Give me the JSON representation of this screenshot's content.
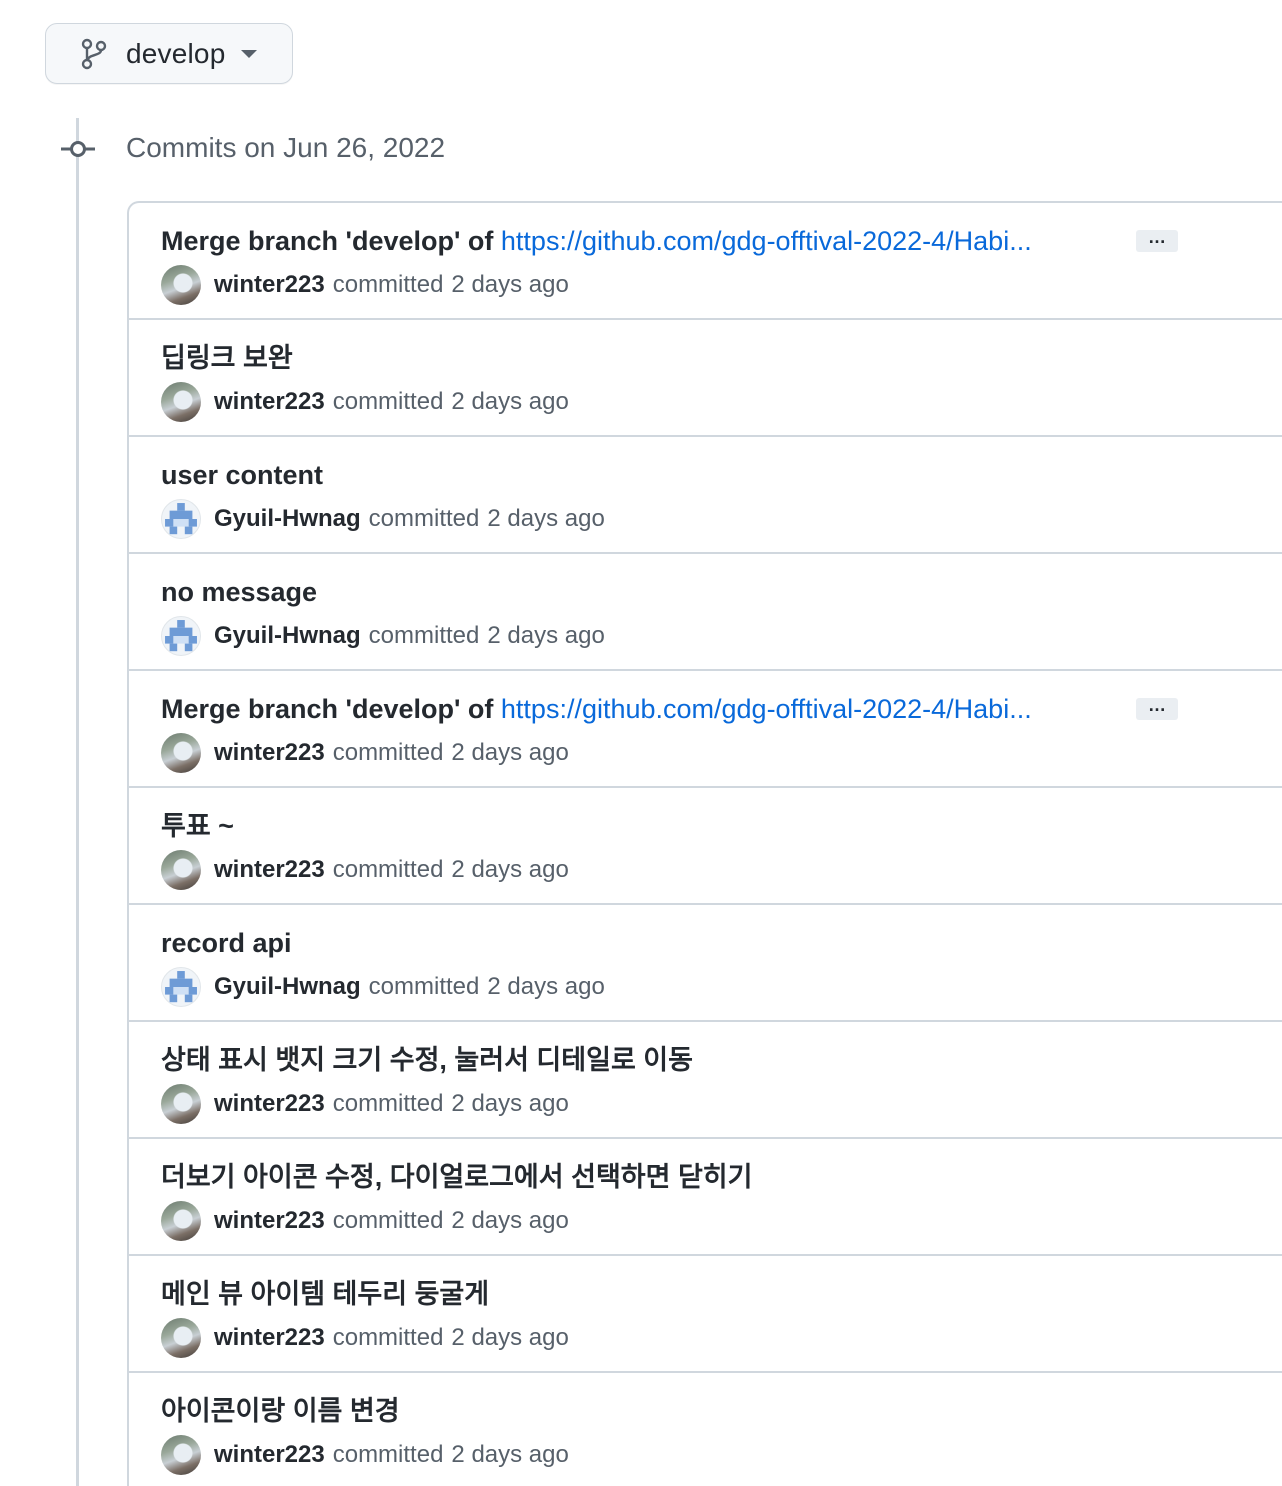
{
  "branch": {
    "name": "develop",
    "icon": "git-branch-icon"
  },
  "timeline": {
    "date_heading": "Commits on Jun 26, 2022"
  },
  "commits": [
    {
      "title": "Merge branch 'develop' of ",
      "link": "https://github.com/gdg-offtival-2022-4/Habi...",
      "has_more": true,
      "author": "winter223",
      "avatar": "photo",
      "committed": "committed",
      "time": "2 days ago"
    },
    {
      "title": "딥링크 보완",
      "link": "",
      "has_more": false,
      "author": "winter223",
      "avatar": "photo",
      "committed": "committed",
      "time": "2 days ago"
    },
    {
      "title": "user content",
      "link": "",
      "has_more": false,
      "author": "Gyuil-Hwnag",
      "avatar": "identicon",
      "committed": "committed",
      "time": "2 days ago"
    },
    {
      "title": "no message",
      "link": "",
      "has_more": false,
      "author": "Gyuil-Hwnag",
      "avatar": "identicon",
      "committed": "committed",
      "time": "2 days ago"
    },
    {
      "title": "Merge branch 'develop' of ",
      "link": "https://github.com/gdg-offtival-2022-4/Habi...",
      "has_more": true,
      "author": "winter223",
      "avatar": "photo",
      "committed": "committed",
      "time": "2 days ago"
    },
    {
      "title": "투표 ~",
      "link": "",
      "has_more": false,
      "author": "winter223",
      "avatar": "photo",
      "committed": "committed",
      "time": "2 days ago"
    },
    {
      "title": "record api",
      "link": "",
      "has_more": false,
      "author": "Gyuil-Hwnag",
      "avatar": "identicon",
      "committed": "committed",
      "time": "2 days ago"
    },
    {
      "title": "상태 표시 뱃지 크기 수정, 눌러서 디테일로 이동",
      "link": "",
      "has_more": false,
      "author": "winter223",
      "avatar": "photo",
      "committed": "committed",
      "time": "2 days ago"
    },
    {
      "title": "더보기 아이콘 수정, 다이얼로그에서 선택하면 닫히기",
      "link": "",
      "has_more": false,
      "author": "winter223",
      "avatar": "photo",
      "committed": "committed",
      "time": "2 days ago"
    },
    {
      "title": "메인 뷰 아이템 테두리 둥굴게",
      "link": "",
      "has_more": false,
      "author": "winter223",
      "avatar": "photo",
      "committed": "committed",
      "time": "2 days ago"
    },
    {
      "title": "아이콘이랑 이름 변경",
      "link": "",
      "has_more": false,
      "author": "winter223",
      "avatar": "photo",
      "committed": "committed",
      "time": "2 days ago"
    }
  ],
  "ui": {
    "ellipsis_label": "…",
    "identicon_color": "#6e9bd6",
    "link_color": "#0969da"
  }
}
